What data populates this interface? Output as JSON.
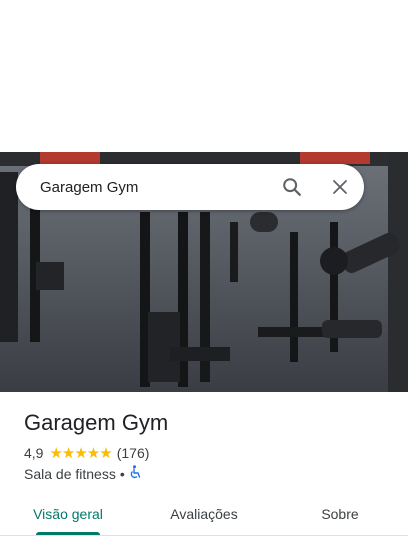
{
  "search": {
    "query": "Garagem Gym"
  },
  "place": {
    "name": "Garagem Gym",
    "rating": "4,9",
    "stars": "★★★★★",
    "review_count": "(176)",
    "category": "Sala de fitness",
    "separator": "•"
  },
  "tabs": [
    {
      "label": "Visão geral",
      "active": true
    },
    {
      "label": "Avaliações",
      "active": false
    },
    {
      "label": "Sobre",
      "active": false
    }
  ],
  "colors": {
    "accent": "#00796b",
    "star": "#fbbc04",
    "accessibility": "#1a73e8"
  }
}
